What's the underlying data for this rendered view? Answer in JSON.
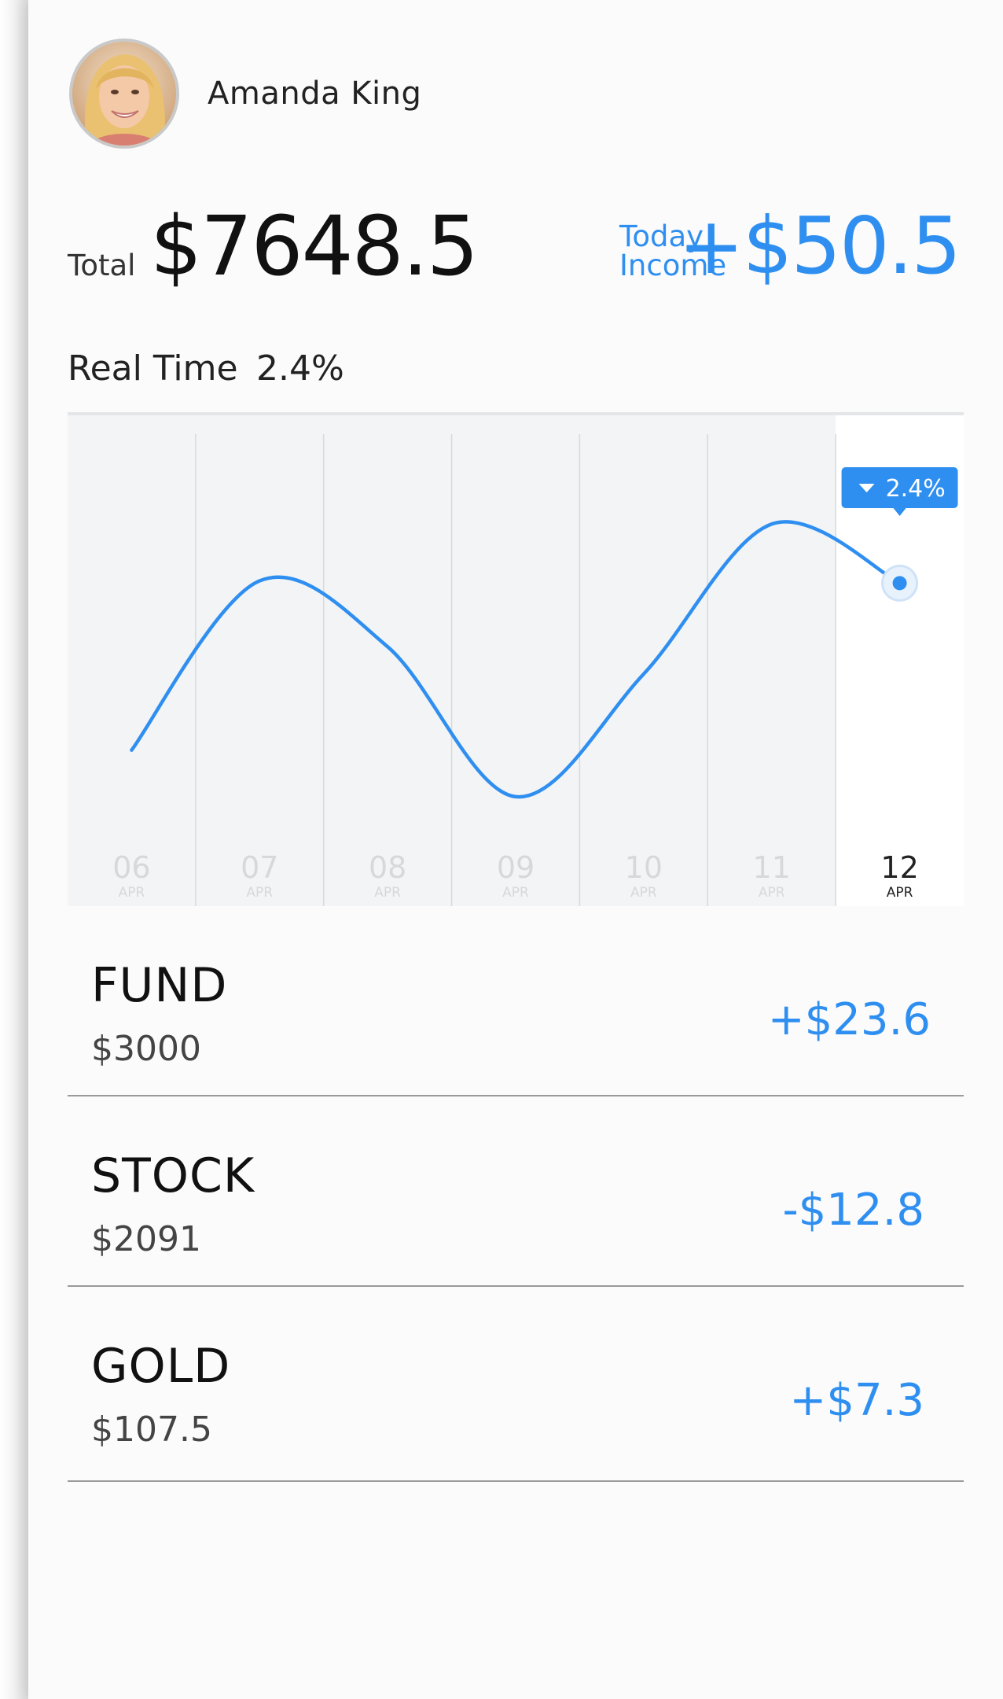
{
  "user": {
    "name": "Amanda King"
  },
  "summary": {
    "total_label": "Total",
    "total_value": "$7648.5",
    "today_label_line1": "Today",
    "today_label_line2": "Income",
    "today_value": "+$50.5"
  },
  "realtime": {
    "label": "Real Time",
    "value": "2.4%"
  },
  "chart_data": {
    "type": "line",
    "x": [
      "06",
      "07",
      "08",
      "09",
      "10",
      "11",
      "12"
    ],
    "x_sublabel": "APR",
    "selected_index": 6,
    "tooltip": "2.4%",
    "grid": true,
    "series": [
      {
        "values": [
          0.93,
          2.42,
          1.84,
          0.52,
          1.6,
          2.92,
          2.4
        ]
      }
    ],
    "ylim": [
      0,
      3.6
    ],
    "colors": {
      "line": "#2f8ff0",
      "tooltip": "#2f8ff0"
    }
  },
  "holdings": [
    {
      "name": "FUND",
      "amount": "$3000",
      "change": "+$23.6"
    },
    {
      "name": "STOCK",
      "amount": "$2091",
      "change": "-$12.8"
    },
    {
      "name": "GOLD",
      "amount": "$107.5",
      "change": "+$7.3"
    }
  ],
  "colors": {
    "accent": "#2f8ff0",
    "text": "#111111"
  }
}
